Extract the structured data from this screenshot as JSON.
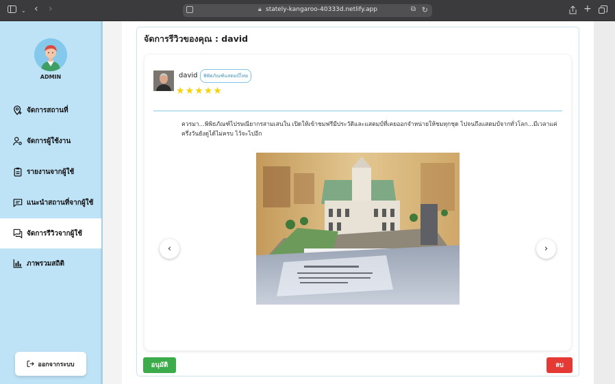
{
  "browser": {
    "url": "stately-kangaroo-40333d.netlify.app",
    "icons": [
      "sidebar-icon",
      "chevron-down-icon",
      "back-icon",
      "forward-icon",
      "translate-icon",
      "reload-icon",
      "share-icon",
      "new-tab-icon",
      "tabs-overview-icon"
    ]
  },
  "sidebar": {
    "role_label": "ADMIN",
    "items": [
      {
        "label": "จัดการสถานที่",
        "icon": "location-pin-icon",
        "active": false
      },
      {
        "label": "จัดการผู้ใช้งาน",
        "icon": "user-settings-icon",
        "active": false
      },
      {
        "label": "รายงานจากผู้ใช้",
        "icon": "clipboard-icon",
        "active": false
      },
      {
        "label": "แนะนำสถานที่จากผู้ใช้",
        "icon": "chat-icon",
        "active": false
      },
      {
        "label": "จัดการรีวิวจากผู้ใช้",
        "icon": "reviews-icon",
        "active": true
      },
      {
        "label": "ภาพรวมสถิติ",
        "icon": "bar-chart-icon",
        "active": false
      }
    ],
    "logout_label": "ออกจากระบบ"
  },
  "main": {
    "title": "จัดการรีวิวของคุณ : david",
    "review": {
      "user_name": "david",
      "place_tag": "พิพิธภัณฑ์แสตมป์ไทย",
      "rating": 5,
      "text": "ควรมา...พิพิธภัณฑ์ไปรษณียากรสามเสนใน เปิดให้เข้าชมฟรีมีประวัติและแสตมป์ที่เคยออกจำหน่ายให้ชมทุกชุด ไปจนถึงแสตมป์จากทั่วโลก...มีเวลาแค่ครึ่งวันยังดูได้ไม่ครบ ไว้จะไปอีก",
      "prev_glyph": "‹",
      "next_glyph": "›"
    },
    "approve_label": "อนุมัติ",
    "delete_label": "ลบ"
  },
  "colors": {
    "sidebar_bg": "#bfe3f6",
    "approve": "#3cab4a",
    "delete": "#e53935",
    "star": "#f5d20c",
    "tag_border": "#7fc4e6"
  }
}
